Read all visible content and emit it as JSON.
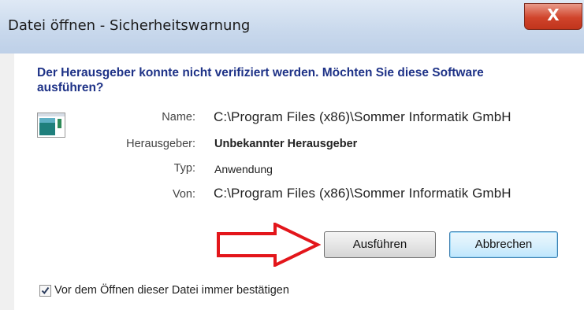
{
  "window": {
    "title": "Datei öffnen - Sicherheitswarnung",
    "close_glyph": "X"
  },
  "dialog": {
    "heading": "Der Herausgeber konnte nicht verifiziert werden. Möchten Sie diese Software ausführen?",
    "file_icon": "application-file-icon",
    "fields": {
      "name": {
        "label": "Name:",
        "value": "C:\\Program Files (x86)\\Sommer Informatik GmbH"
      },
      "publisher": {
        "label": "Herausgeber:",
        "value": "Unbekannter Herausgeber"
      },
      "type": {
        "label": "Typ:",
        "value": "Anwendung"
      },
      "from": {
        "label": "Von:",
        "value": "C:\\Program Files (x86)\\Sommer Informatik GmbH"
      }
    },
    "buttons": {
      "run": "Ausführen",
      "cancel": "Abbrechen"
    },
    "annotation": {
      "icon": "red-arrow-icon",
      "color": "#e3161b"
    },
    "checkbox": {
      "checked": true,
      "label": "Vor dem Öffnen dieser Datei immer bestätigen"
    }
  }
}
